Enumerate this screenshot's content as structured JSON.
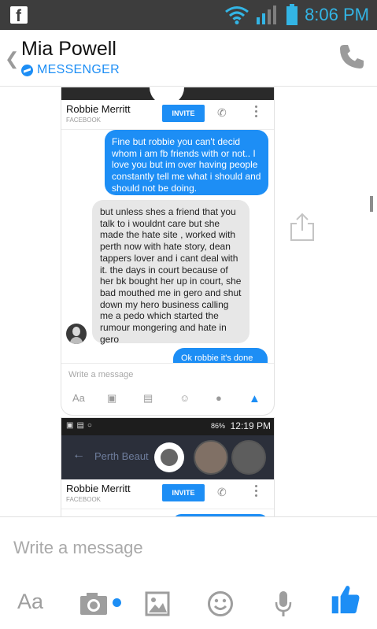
{
  "status_bar": {
    "time": "8:06 PM"
  },
  "header": {
    "title": "Mia Powell",
    "subtitle": "MESSENGER"
  },
  "shared_screenshot": {
    "contact_name": "Robbie Merritt",
    "contact_source": "FACEBOOK",
    "invite_label": "INVITE",
    "message_out": "Fine but robbie you can't decid whom i am fb friends with or not.. I love you but im over having people constantly tell me what i should and should not be doing.",
    "message_in": "but unless shes a friend that you talk to i wouldnt care but she made the hate site , worked with perth now with hate story, dean tappers lover and  i cant deal with it. the days in court because of her bk bought her up in court, she bad mouthed me in gero and shut down my hero business calling me a pedo which started the rumour mongering and hate in gero",
    "message_peek": "Ok robbie it's done",
    "compose_placeholder": "Write a message",
    "compose_aa": "Aa"
  },
  "shared_screenshot_2": {
    "status_battery": "86%",
    "status_time": "12:19 PM",
    "nav_title": "Perth Beaut",
    "contact_name": "Robbie Merritt",
    "contact_source": "FACEBOOK",
    "invite_label": "INVITE"
  },
  "compose": {
    "placeholder": "Write a message",
    "aa_label": "Aa"
  },
  "colors": {
    "accent": "#1d8ef5",
    "status_bar": "#3d3d3d",
    "status_time": "#33b5e5",
    "bubble_in": "#e7e7e7"
  }
}
